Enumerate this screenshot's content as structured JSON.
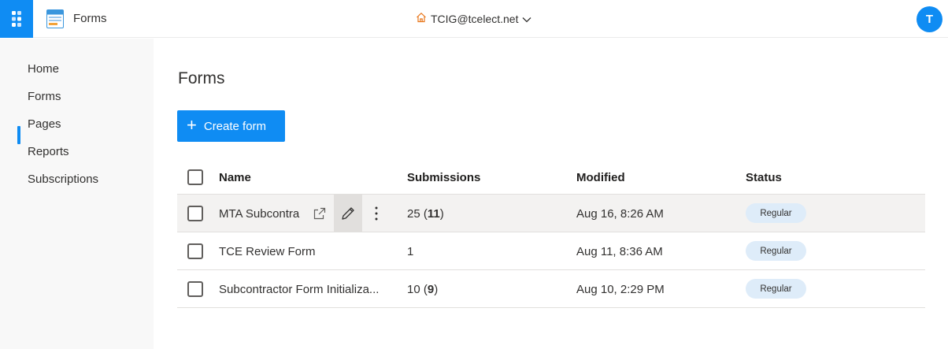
{
  "app": {
    "title": "Forms"
  },
  "tenant": {
    "label": "TCIG@tcelect.net"
  },
  "user": {
    "avatar_initial": "T"
  },
  "sidebar": {
    "items": [
      {
        "label": "Home"
      },
      {
        "label": "Forms",
        "active": true
      },
      {
        "label": "Pages"
      },
      {
        "label": "Reports"
      },
      {
        "label": "Subscriptions"
      }
    ]
  },
  "main": {
    "page_title": "Forms",
    "create_button": {
      "icon": "+",
      "label": "Create form"
    },
    "table": {
      "columns": {
        "name": "Name",
        "submissions": "Submissions",
        "modified": "Modified",
        "status": "Status"
      },
      "rows": [
        {
          "name": "MTA Subcontra",
          "submissions_total": "25",
          "submissions_new": "11",
          "modified": "Aug 16, 8:26 AM",
          "status": "Regular"
        },
        {
          "name": "TCE Review Form",
          "submissions_total": "1",
          "submissions_new": "",
          "modified": "Aug 11, 8:36 AM",
          "status": "Regular"
        },
        {
          "name": "Subcontractor Form Initializa...",
          "submissions_total": "10",
          "submissions_new": "9",
          "modified": "Aug 10, 2:29 PM",
          "status": "Regular"
        }
      ]
    }
  },
  "colors": {
    "accent": "#0f8cf3",
    "badge_bg": "#deecf9",
    "sidebar_bg": "#f8f8f8"
  },
  "icons": [
    "waffle-icon",
    "forms-app-icon",
    "home-icon",
    "chevron-down-icon",
    "plus-icon",
    "open-in-new-icon",
    "pencil-icon",
    "more-vertical-icon"
  ]
}
